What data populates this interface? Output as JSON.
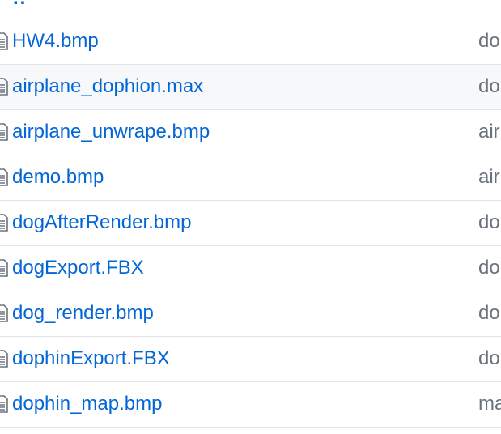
{
  "parent_dir": {
    "label": ".."
  },
  "files": [
    {
      "name": "HW4.bmp",
      "commit": "do"
    },
    {
      "name": "airplane_dophion.max",
      "commit": "do"
    },
    {
      "name": "airplane_unwrape.bmp",
      "commit": "air"
    },
    {
      "name": "demo.bmp",
      "commit": "air"
    },
    {
      "name": "dogAfterRender.bmp",
      "commit": "do"
    },
    {
      "name": "dogExport.FBX",
      "commit": "do"
    },
    {
      "name": "dog_render.bmp",
      "commit": "do"
    },
    {
      "name": "dophinExport.FBX",
      "commit": "do"
    },
    {
      "name": "dophin_map.bmp",
      "commit": "ma"
    }
  ],
  "icons": {
    "file": "file-icon"
  },
  "colors": {
    "link": "#0366d6",
    "muted": "#6a737d",
    "border": "#e1e4e8",
    "hover_bg": "#f6f8fa"
  }
}
